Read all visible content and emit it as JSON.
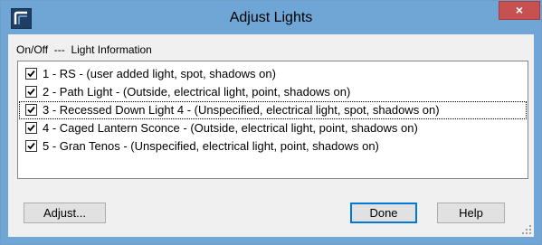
{
  "window": {
    "title": "Adjust Lights",
    "close_label": "×"
  },
  "header": {
    "label": "On/Off  ---  Light Information"
  },
  "lights": [
    {
      "label": "1 - RS - (user added light, spot, shadows on)",
      "checked": true
    },
    {
      "label": "2 - Path Light - (Outside, electrical light, point, shadows on)",
      "checked": true
    },
    {
      "label": "3 - Recessed Down Light 4 - (Unspecified, electrical light, spot, shadows on)",
      "checked": true,
      "focused": true
    },
    {
      "label": "4 - Caged Lantern Sconce - (Outside, electrical light, point, shadows on)",
      "checked": true
    },
    {
      "label": "5 - Gran Tenos - (Unspecified, electrical light, point, shadows on)",
      "checked": true
    }
  ],
  "buttons": {
    "adjust": "Adjust...",
    "done": "Done",
    "help": "Help"
  },
  "colors": {
    "titlebar": "#6fa6d6",
    "close": "#c75050",
    "client": "#f0f0f0",
    "default_button_border": "#0078d7"
  }
}
